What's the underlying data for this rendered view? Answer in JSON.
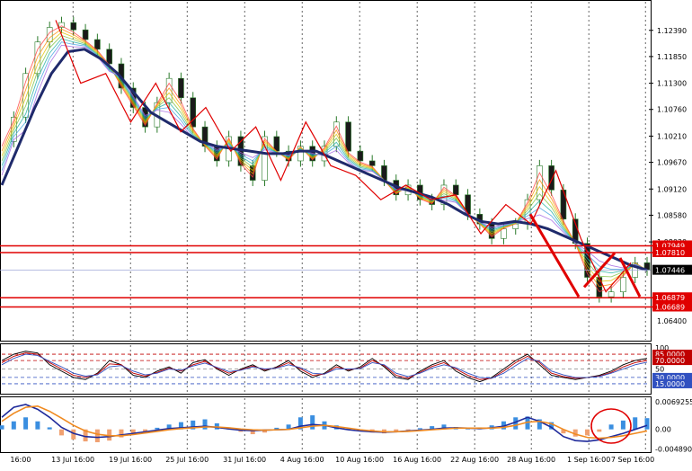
{
  "chart_data": [
    {
      "type": "line",
      "panel": "price",
      "ylim": [
        1.0605,
        1.1283
      ],
      "price_labels": [
        "1.12390",
        "1.11850",
        "1.11300",
        "1.10760",
        "1.10210",
        "1.09670",
        "1.09120",
        "1.08580",
        "1.08030"
      ],
      "price_values": [
        1.1239,
        1.1185,
        1.113,
        1.1076,
        1.1021,
        1.0967,
        1.0912,
        1.0858,
        1.0803
      ],
      "lower_label": "1.06400",
      "lower_value": 1.064,
      "horizontal_levels": [
        {
          "label": "1.07949",
          "value": 1.07949,
          "color": "#e00000"
        },
        {
          "label": "1.07810",
          "value": 1.0781,
          "color": "#e00000"
        },
        {
          "label": "1.06879",
          "value": 1.06879,
          "color": "#e00000"
        },
        {
          "label": "1.06689",
          "value": 1.06689,
          "color": "#e00000"
        }
      ],
      "current_price": {
        "label": "1.07446",
        "value": 1.07446
      },
      "moving_average_color": "#1f2a6b",
      "zigzag_color": "#e00000",
      "close_prices": [
        1.101,
        1.106,
        1.115,
        1.1215,
        1.1245,
        1.1255,
        1.124,
        1.122,
        1.12,
        1.117,
        1.112,
        1.108,
        1.104,
        1.109,
        1.114,
        1.11,
        1.104,
        1.1,
        1.097,
        1.102,
        1.096,
        1.093,
        1.102,
        1.099,
        1.097,
        1.1,
        1.097,
        1.1,
        1.105,
        1.099,
        1.097,
        1.096,
        1.093,
        1.09,
        1.092,
        1.089,
        1.088,
        1.092,
        1.09,
        1.086,
        1.084,
        1.081,
        1.083,
        1.084,
        1.089,
        1.096,
        1.091,
        1.085,
        1.08,
        1.073,
        1.069,
        1.07,
        1.073,
        1.076,
        1.0745
      ],
      "ma_values": [
        1.092,
        1.1,
        1.108,
        1.115,
        1.1195,
        1.12,
        1.118,
        1.115,
        1.111,
        1.107,
        1.105,
        1.103,
        1.101,
        1.1,
        1.0995,
        1.099,
        1.0985,
        1.0985,
        1.099,
        1.099,
        1.0975,
        1.096,
        1.0945,
        1.093,
        1.0915,
        1.0905,
        1.0895,
        1.088,
        1.086,
        1.0845,
        1.084,
        1.0845,
        1.084,
        1.083,
        1.0815,
        1.08,
        1.0785,
        1.077,
        1.0755,
        1.0745
      ],
      "zigzag": [
        1.126,
        1.113,
        1.115,
        1.105,
        1.113,
        1.103,
        1.108,
        1.099,
        1.104,
        1.093,
        1.105,
        1.096,
        1.094,
        1.089,
        1.092,
        1.089,
        1.09,
        1.082,
        1.088,
        1.084,
        1.095,
        1.081,
        1.07,
        1.076
      ]
    },
    {
      "type": "line",
      "panel": "stochastic",
      "ylim": [
        0,
        100
      ],
      "levels": [
        {
          "label": "85.0000",
          "value": 85,
          "color": "#c00000"
        },
        {
          "label": "70.0000",
          "value": 70,
          "color": "#c00000"
        },
        {
          "label": "50",
          "value": 50,
          "color": "#888888"
        },
        {
          "label": "30.0000",
          "value": 30,
          "color": "#3050c0"
        },
        {
          "label": "15.0000",
          "value": 15,
          "color": "#3050c0"
        }
      ],
      "top_label": "100",
      "series": [
        {
          "values": [
            70,
            85,
            92,
            88,
            60,
            45,
            30,
            25,
            40,
            70,
            60,
            35,
            30,
            45,
            55,
            40,
            65,
            72,
            50,
            35,
            50,
            60,
            45,
            55,
            70,
            45,
            30,
            40,
            60,
            45,
            55,
            75,
            55,
            30,
            25,
            45,
            60,
            70,
            45,
            30,
            20,
            30,
            50,
            70,
            85,
            60,
            35,
            30,
            25,
            30,
            35,
            45,
            60,
            70,
            75
          ],
          "color": "#000000"
        },
        {
          "values": [
            65,
            80,
            88,
            85,
            65,
            50,
            35,
            30,
            38,
            62,
            60,
            40,
            33,
            42,
            52,
            45,
            60,
            68,
            52,
            40,
            48,
            57,
            48,
            53,
            65,
            50,
            35,
            38,
            55,
            48,
            52,
            70,
            58,
            35,
            28,
            42,
            56,
            65,
            50,
            35,
            25,
            28,
            45,
            65,
            80,
            65,
            40,
            32,
            28,
            30,
            33,
            42,
            55,
            65,
            70
          ],
          "color": "#c00000"
        },
        {
          "values": [
            60,
            75,
            85,
            82,
            68,
            55,
            40,
            33,
            36,
            55,
            58,
            45,
            36,
            40,
            50,
            47,
            57,
            64,
            54,
            44,
            47,
            55,
            50,
            52,
            60,
            53,
            40,
            38,
            50,
            50,
            51,
            65,
            60,
            40,
            32,
            40,
            52,
            60,
            53,
            40,
            30,
            28,
            40,
            58,
            75,
            68,
            45,
            36,
            30,
            30,
            32,
            40,
            50,
            60,
            66
          ],
          "color": "#3050c0"
        }
      ]
    },
    {
      "type": "bar",
      "panel": "macd",
      "ylim": [
        -0.005,
        0.0071
      ],
      "tick_labels": [
        {
          "label": "0.0069255",
          "value": 0.0069255
        },
        {
          "label": "0.00",
          "value": 0.0
        },
        {
          "label": "-0.0048908",
          "value": -0.0048908
        }
      ],
      "positive_color": "#3a8ee0",
      "negative_color": "#f0a070",
      "histogram": [
        0.001,
        0.002,
        0.003,
        0.002,
        0.0005,
        -0.0015,
        -0.0025,
        -0.003,
        -0.0032,
        -0.0028,
        -0.002,
        -0.0012,
        -0.0005,
        0.0004,
        0.0012,
        0.0018,
        0.0022,
        0.0025,
        0.0015,
        0.0005,
        -0.0006,
        -0.0012,
        -0.0008,
        0.0004,
        0.0012,
        0.003,
        0.0035,
        0.002,
        0.001,
        0.0002,
        -0.0004,
        -0.0008,
        -0.001,
        -0.0006,
        -0.0002,
        0.0003,
        0.0008,
        0.0012,
        0.0006,
        0.0003,
        0.0005,
        0.001,
        0.002,
        0.003,
        0.0032,
        0.0025,
        0.0018,
        -0.001,
        -0.0018,
        -0.0015,
        -0.0006,
        0.0012,
        0.0022,
        0.003,
        0.0028
      ],
      "series": [
        {
          "values": [
            0.003,
            0.0055,
            0.0062,
            0.005,
            0.003,
            0.0005,
            -0.001,
            -0.0018,
            -0.002,
            -0.0018,
            -0.0014,
            -0.001,
            -0.0006,
            -0.0002,
            0.0002,
            0.0004,
            0.0006,
            0.0008,
            0.0005,
            0.0001,
            -0.0002,
            -0.0003,
            -0.0002,
            -0.0001,
            0.0,
            0.0008,
            0.0012,
            0.001,
            0.0004,
            -0.0001,
            -0.0004,
            -0.0006,
            -0.0007,
            -0.0006,
            -0.0004,
            -0.0002,
            0.0,
            0.0003,
            0.0004,
            0.0003,
            0.0002,
            0.0004,
            0.0008,
            0.0018,
            0.003,
            0.002,
            0.0005,
            -0.0018,
            -0.0028,
            -0.003,
            -0.0026,
            -0.0018,
            -0.001,
            0.0,
            0.001
          ],
          "color": "#1f2a9b"
        },
        {
          "values": [
            0.002,
            0.004,
            0.0055,
            0.0058,
            0.0045,
            0.0028,
            0.001,
            -0.0004,
            -0.0012,
            -0.0016,
            -0.0016,
            -0.0013,
            -0.0009,
            -0.0005,
            -0.0001,
            0.0002,
            0.0004,
            0.0006,
            0.0006,
            0.0004,
            0.0001,
            -0.0001,
            -0.0002,
            -0.0001,
            0.0,
            0.0004,
            0.0008,
            0.001,
            0.0007,
            0.0003,
            -0.0001,
            -0.0004,
            -0.0006,
            -0.0006,
            -0.0005,
            -0.0003,
            -0.0001,
            0.0001,
            0.0003,
            0.0003,
            0.0003,
            0.0003,
            0.0005,
            0.001,
            0.0018,
            0.002,
            0.0014,
            0.0,
            -0.0012,
            -0.002,
            -0.0022,
            -0.002,
            -0.0016,
            -0.001,
            -0.0004
          ],
          "color": "#f08a20"
        }
      ]
    }
  ],
  "x_axis": {
    "labels": [
      "16:00",
      "13 Jul 16:00",
      "19 Jul 16:00",
      "25 Jul 16:00",
      "31 Jul 16:00",
      "4 Aug 16:00",
      "10 Aug 16:00",
      "16 Aug 16:00",
      "22 Aug 16:00",
      "28 Aug 16:00",
      "1 Sep 16:00",
      "7 Sep 16:00"
    ]
  }
}
